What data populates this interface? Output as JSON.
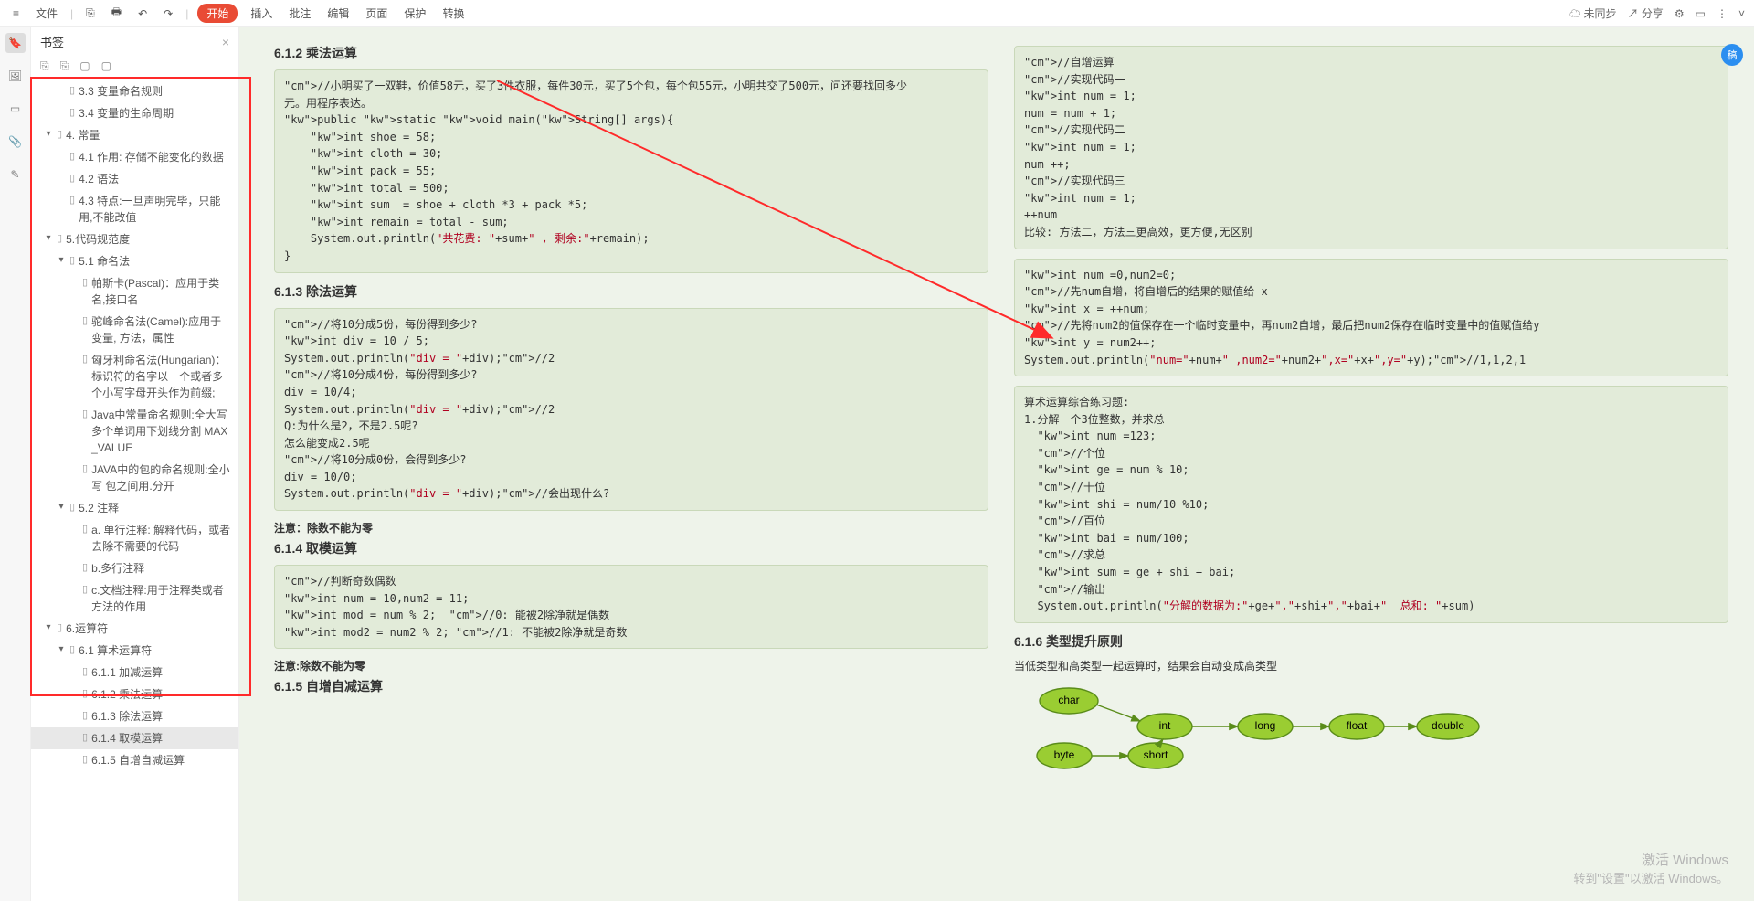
{
  "toolbar": {
    "menu": "≡",
    "file": "文件",
    "open": "⎘",
    "save": "🖶",
    "undo": "↶",
    "redo": "↷",
    "start": "开始",
    "insert": "插入",
    "annotate": "批注",
    "edit": "编辑",
    "page": "页面",
    "protect": "保护",
    "convert": "转换",
    "sync": "未同步",
    "share": "分享"
  },
  "sidebar": {
    "title": "书签",
    "close": "×",
    "tools": {
      "t1": "⎘",
      "t2": "⎘",
      "t3": "▢",
      "t4": "▢"
    },
    "items": [
      {
        "lv": 2,
        "label": "3.3 变量命名规则"
      },
      {
        "lv": 2,
        "label": "3.4 变量的生命周期"
      },
      {
        "lv": 1,
        "toggle": "▾",
        "label": "4. 常量"
      },
      {
        "lv": 2,
        "label": "4.1 作用: 存储不能变化的数据"
      },
      {
        "lv": 2,
        "label": "4.2 语法"
      },
      {
        "lv": 2,
        "label": "4.3 特点:一旦声明完毕，只能用,不能改值"
      },
      {
        "lv": 1,
        "toggle": "▾",
        "label": "5.代码规范度"
      },
      {
        "lv": 2,
        "toggle": "▾",
        "label": "5.1 命名法"
      },
      {
        "lv": 3,
        "label": "帕斯卡(Pascal)：应用于类名,接口名"
      },
      {
        "lv": 3,
        "label": "驼峰命名法(Camel):应用于变量, 方法，属性"
      },
      {
        "lv": 3,
        "label": "匈牙利命名法(Hungarian)：标识符的名字以一个或者多个小写字母开头作为前缀;"
      },
      {
        "lv": 3,
        "label": "Java中常量命名规则:全大写 多个单词用下划线分割  MAX_VALUE"
      },
      {
        "lv": 3,
        "label": "JAVA中的包的命名规则:全小写 包之间用.分开"
      },
      {
        "lv": 2,
        "toggle": "▾",
        "label": "5.2 注释"
      },
      {
        "lv": 3,
        "label": "a. 单行注释: 解释代码，或者去除不需要的代码"
      },
      {
        "lv": 3,
        "label": "b.多行注释"
      },
      {
        "lv": 3,
        "label": "c.文档注释:用于注释类或者方法的作用"
      },
      {
        "lv": 1,
        "toggle": "▾",
        "label": "6.运算符"
      },
      {
        "lv": 2,
        "toggle": "▾",
        "label": "6.1 算术运算符"
      },
      {
        "lv": 3,
        "label": "6.1.1 加减运算"
      },
      {
        "lv": 3,
        "label": "6.1.2 乘法运算"
      },
      {
        "lv": 3,
        "label": "6.1.3 除法运算"
      },
      {
        "lv": 3,
        "label": "6.1.4 取模运算",
        "sel": true
      },
      {
        "lv": 3,
        "label": "6.1.5 自增自减运算"
      }
    ]
  },
  "left": {
    "h612": "6.1.2 乘法运算",
    "code612": "//小明买了一双鞋，价值58元，买了3件衣服，每件30元，买了5个包，每个包55元，小明共交了500元，问还要找回多少\n元。用程序表达。\npublic static void main(String[] args){\n    int shoe = 58;\n    int cloth = 30;\n    int pack = 55;\n    int total = 500;\n    int sum  = shoe + cloth *3 + pack *5;\n    int remain = total - sum;\n    System.out.println(\"共花费: \"+sum+\" , 剩余:\"+remain);\n}",
    "h613": "6.1.3 除法运算",
    "code613": "//将10分成5份，每份得到多少?\nint div = 10 / 5;\nSystem.out.println(\"div = \"+div);//2\n//将10分成4份，每份得到多少?\ndiv = 10/4;\nSystem.out.println(\"div = \"+div);//2\nQ:为什么是2，不是2.5呢?\n怎么能变成2.5呢\n//将10分成0份，会得到多少?\ndiv = 10/0;\nSystem.out.println(\"div = \"+div);//会出现什么?",
    "note613": "注意：除数不能为零",
    "h614": "6.1.4 取模运算",
    "code614": "//判断奇数偶数\nint num = 10,num2 = 11;\nint mod = num % 2;  //0: 能被2除净就是偶数\nint mod2 = num2 % 2; //1: 不能被2除净就是奇数",
    "note614": "注意:除数不能为零",
    "h615": "6.1.5 自增自减运算"
  },
  "right": {
    "code615": "//自增运算\n//实现代码一\nint num = 1;\nnum = num + 1;\n//实现代码二\nint num = 1;\nnum ++;\n//实现代码三\nint num = 1;\n++num\n比较: 方法二，方法三更高效，更方便,无区别",
    "code615b": "int num =0,num2=0;\n//先num自增，将自增后的结果的赋值给 x\nint x = ++num;\n//先将num2的值保存在一个临时变量中，再num2自增，最后把num2保存在临时变量中的值赋值给y\nint y = num2++;\nSystem.out.println(\"num=\"+num+\" ,num2=\"+num2+\",x=\"+x+\",y=\"+y);//1,1,2,1",
    "code615c": "算术运算综合练习题:\n1.分解一个3位整数，并求总\n  int num =123;\n  //个位\n  int ge = num % 10;\n  //十位\n  int shi = num/10 %10;\n  //百位\n  int bai = num/100;\n  //求总\n  int sum = ge + shi + bai;\n  //输出\n  System.out.println(\"分解的数据为:\"+ge+\",\"+shi+\",\"+bai+\"  总和: \"+sum)",
    "h616": "6.1.6 类型提升原则",
    "text616": "当低类型和高类型一起运算时，结果会自动变成高类型",
    "nodes": {
      "char": "char",
      "int": "int",
      "long": "long",
      "float": "float",
      "double": "double",
      "byte": "byte",
      "short": "short"
    }
  },
  "watermark": {
    "l1": "激活 Windows",
    "l2": "转到\"设置\"以激活 Windows。"
  }
}
